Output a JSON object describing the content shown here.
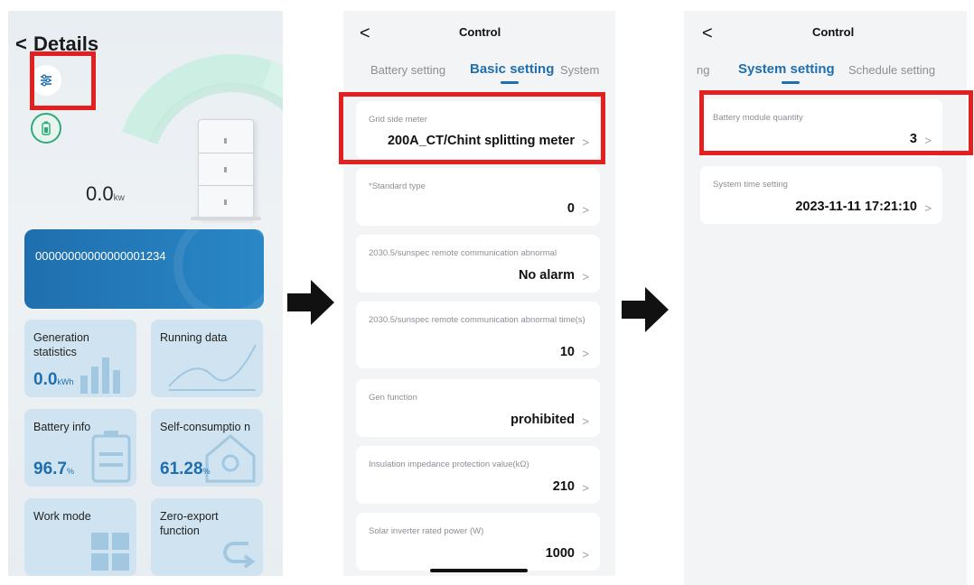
{
  "screen1": {
    "back_glyph": "<",
    "title": "Details",
    "power_value": "0.0",
    "power_unit": "kw",
    "serial_number": "00000000000000001234",
    "tiles": [
      {
        "label": "Generation statistics",
        "value": "0.0",
        "unit": "kWh"
      },
      {
        "label": "Running data",
        "value": "",
        "unit": ""
      },
      {
        "label": "Battery info",
        "value": "96.7",
        "unit": "%"
      },
      {
        "label": "Self-consumptio n",
        "value": "61.28",
        "unit": "%"
      },
      {
        "label": "Work mode",
        "value": "",
        "unit": ""
      },
      {
        "label": "Zero-export function",
        "value": "",
        "unit": ""
      }
    ],
    "icons": [
      "settings-sliders-icon",
      "battery-icon"
    ]
  },
  "screen2": {
    "back_glyph": "<",
    "title": "Control",
    "tabs": [
      "Battery setting",
      "Basic setting",
      "System"
    ],
    "active_tab": "Basic setting",
    "items": [
      {
        "label": "Grid side meter",
        "value": "200A_CT/Chint splitting meter"
      },
      {
        "label": "*Standard type",
        "value": "0"
      },
      {
        "label": "2030.5/sunspec remote communication abnormal",
        "value": "No alarm"
      },
      {
        "label": "2030.5/sunspec remote communication abnormal time(s)",
        "value": "10"
      },
      {
        "label": "Gen function",
        "value": "prohibited"
      },
      {
        "label": "Insulation impedance protection value(kΩ)",
        "value": "210"
      },
      {
        "label": "Solar inverter rated power (W)",
        "value": "1000"
      }
    ],
    "chevron": ">"
  },
  "screen3": {
    "back_glyph": "<",
    "title": "Control",
    "tabs": [
      "ng",
      "System setting",
      "Schedule setting"
    ],
    "active_tab": "System setting",
    "items": [
      {
        "label": "Battery module quantity",
        "value": "3"
      },
      {
        "label": "System time setting",
        "value": "2023-11-11 17:21:10"
      }
    ],
    "chevron": ">"
  },
  "colors": {
    "accent": "#1f6fae",
    "highlight": "#e41f1f",
    "gauge": "#cdeee2",
    "battery_icon": "#2eaa7a"
  }
}
